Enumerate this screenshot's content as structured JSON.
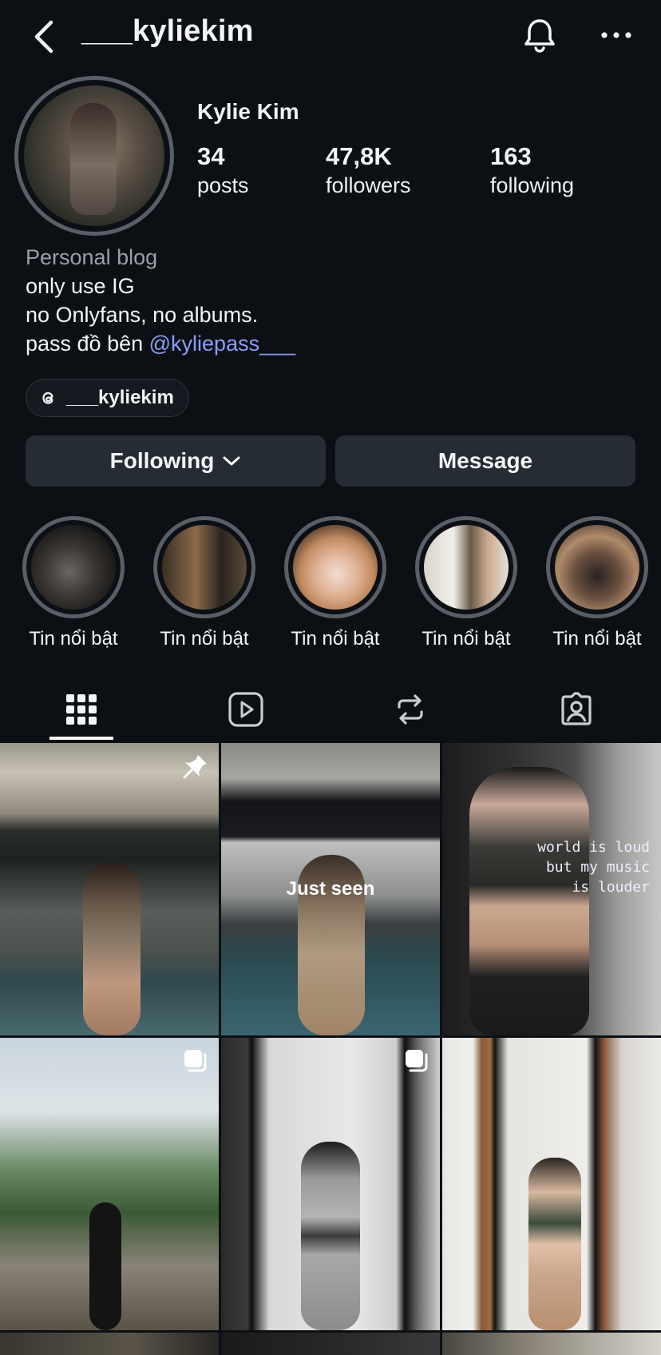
{
  "header": {
    "username": "___kyliekim",
    "back_icon": "chevron-left-icon",
    "bell_icon": "bell-icon",
    "more_icon": "more-horizontal-icon"
  },
  "profile": {
    "display_name": "Kylie Kim",
    "stats": [
      {
        "value": "34",
        "label": "posts"
      },
      {
        "value": "47,8K",
        "label": "followers"
      },
      {
        "value": "163",
        "label": "following"
      }
    ],
    "bio": {
      "category": "Personal blog",
      "line1": "only use IG",
      "line2": "no Onlyfans, no albums.",
      "line3_prefix": "pass đồ bên ",
      "line3_mention": "@kyliepass___"
    },
    "threads_handle": "___kyliekim"
  },
  "actions": {
    "following_label": "Following",
    "message_label": "Message"
  },
  "highlights": [
    {
      "label": "Tin nổi bật"
    },
    {
      "label": "Tin nổi bật"
    },
    {
      "label": "Tin nổi bật"
    },
    {
      "label": "Tin nổi bật"
    },
    {
      "label": "Tin nổi bật"
    }
  ],
  "tabs": [
    {
      "icon": "grid-icon",
      "active": true
    },
    {
      "icon": "reels-icon",
      "active": false
    },
    {
      "icon": "reposts-icon",
      "active": false
    },
    {
      "icon": "tagged-icon",
      "active": false
    }
  ],
  "posts": [
    {
      "overlay": "",
      "badge": "pin-icon"
    },
    {
      "overlay": "Just seen",
      "badge": ""
    },
    {
      "overlay": "",
      "badge": "",
      "caption": "world is loud\nbut my music\nis louder"
    },
    {
      "overlay": "",
      "badge": "carousel-icon"
    },
    {
      "overlay": "",
      "badge": "carousel-icon"
    },
    {
      "overlay": "",
      "badge": ""
    }
  ],
  "colors": {
    "background": "#0c1015",
    "button": "#262c34",
    "mention": "#8a9ff7",
    "muted": "#9aa0a8"
  }
}
